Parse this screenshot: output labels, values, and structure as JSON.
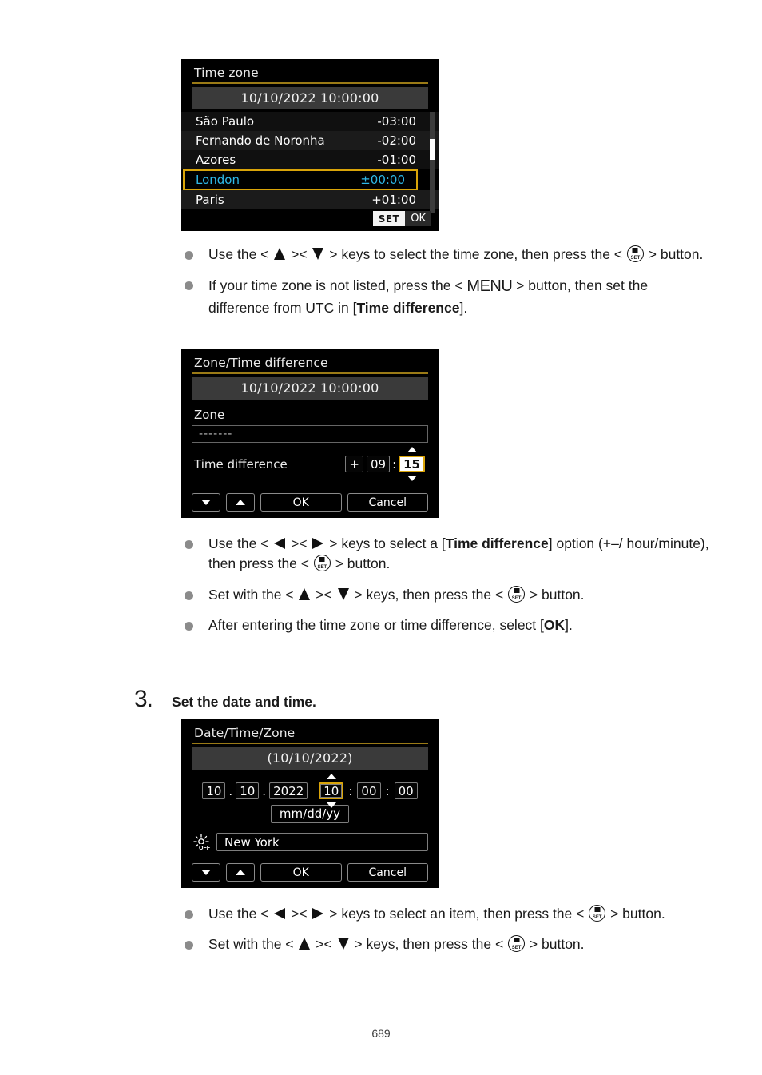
{
  "page": {
    "number": "689"
  },
  "screen_timezone": {
    "title": "Time zone",
    "datetime_bar": "10/10/2022 10:00:00",
    "rows": [
      {
        "name": "São Paulo",
        "offset": "-03:00",
        "selected": false
      },
      {
        "name": "Fernando de Noronha",
        "offset": "-02:00",
        "selected": false
      },
      {
        "name": "Azores",
        "offset": "-01:00",
        "selected": false
      },
      {
        "name": "London",
        "offset": "±00:00",
        "selected": true
      },
      {
        "name": "Paris",
        "offset": "+01:00",
        "selected": false
      }
    ],
    "footer": {
      "set_label": "SET",
      "ok_label": "OK"
    },
    "colors": {
      "highlight_border": "#d9a409",
      "highlight_text": "#2fb8e8",
      "title_rule": "#9a7a16"
    }
  },
  "bullets_after_timezone": [
    {
      "segments": [
        {
          "type": "text",
          "value": "Use the < "
        },
        {
          "type": "icon",
          "value": "arrow-up-key"
        },
        {
          "type": "text",
          "value": " >< "
        },
        {
          "type": "icon",
          "value": "arrow-down-key"
        },
        {
          "type": "text",
          "value": " > keys to select the time zone, then press the < "
        },
        {
          "type": "icon",
          "value": "set-button"
        },
        {
          "type": "text",
          "value": " > button."
        }
      ]
    },
    {
      "segments": [
        {
          "type": "text",
          "value": "If your time zone is not listed, press the < "
        },
        {
          "type": "icon",
          "value": "menu-button"
        },
        {
          "type": "text",
          "value": " > button, then set the difference from UTC in ["
        },
        {
          "type": "bold",
          "value": "Time difference"
        },
        {
          "type": "text",
          "value": "]."
        }
      ]
    }
  ],
  "screen_zonediff": {
    "title": "Zone/Time difference",
    "datetime_bar": "10/10/2022 10:00:00",
    "zone_label": "Zone",
    "zone_value": "-------",
    "time_difference_label": "Time difference",
    "sign": "+",
    "hours": "09",
    "colon": ":",
    "minutes": "15",
    "selected_field": "minutes",
    "buttons": {
      "down_icon": "triangle-down-icon",
      "up_icon": "triangle-up-icon",
      "ok": "OK",
      "cancel": "Cancel"
    }
  },
  "bullets_after_zonediff": [
    {
      "segments": [
        {
          "type": "text",
          "value": "Use the < "
        },
        {
          "type": "icon",
          "value": "arrow-left-key"
        },
        {
          "type": "text",
          "value": " >< "
        },
        {
          "type": "icon",
          "value": "arrow-right-key"
        },
        {
          "type": "text",
          "value": " > keys to select a ["
        },
        {
          "type": "bold",
          "value": "Time difference"
        },
        {
          "type": "text",
          "value": "] option (+–/hour/minute), then press the < "
        },
        {
          "type": "icon",
          "value": "set-button"
        },
        {
          "type": "text",
          "value": " > button."
        }
      ]
    },
    {
      "segments": [
        {
          "type": "text",
          "value": "Set with the < "
        },
        {
          "type": "icon",
          "value": "arrow-up-key"
        },
        {
          "type": "text",
          "value": " >< "
        },
        {
          "type": "icon",
          "value": "arrow-down-key"
        },
        {
          "type": "text",
          "value": " > keys, then press the < "
        },
        {
          "type": "icon",
          "value": "set-button"
        },
        {
          "type": "text",
          "value": " > button."
        }
      ]
    },
    {
      "segments": [
        {
          "type": "text",
          "value": "After entering the time zone or time difference, select ["
        },
        {
          "type": "bold",
          "value": "OK"
        },
        {
          "type": "text",
          "value": "]."
        }
      ]
    }
  ],
  "step": {
    "number": "3.",
    "title": "Set the date and time."
  },
  "screen_datetime": {
    "title": "Date/Time/Zone",
    "date_bar": "(10/10/2022)",
    "month": "10",
    "day": "10",
    "year": "2022",
    "hour": "10",
    "minute": "00",
    "second": "00",
    "selected_field": "hour",
    "separator_date": ".",
    "separator_time": ":",
    "format": "mm/dd/yy",
    "dst_icon": "daylight-saving-off-icon",
    "dst_state": "OFF",
    "zone_value": "New York",
    "buttons": {
      "down_icon": "triangle-down-icon",
      "up_icon": "triangle-up-icon",
      "ok": "OK",
      "cancel": "Cancel"
    }
  },
  "bullets_after_datetime": [
    {
      "segments": [
        {
          "type": "text",
          "value": "Use the < "
        },
        {
          "type": "icon",
          "value": "arrow-left-key"
        },
        {
          "type": "text",
          "value": " >< "
        },
        {
          "type": "icon",
          "value": "arrow-right-key"
        },
        {
          "type": "text",
          "value": " > keys to select an item, then press the < "
        },
        {
          "type": "icon",
          "value": "set-button"
        },
        {
          "type": "text",
          "value": " > button."
        }
      ]
    },
    {
      "segments": [
        {
          "type": "text",
          "value": "Set with the < "
        },
        {
          "type": "icon",
          "value": "arrow-up-key"
        },
        {
          "type": "text",
          "value": " >< "
        },
        {
          "type": "icon",
          "value": "arrow-down-key"
        },
        {
          "type": "text",
          "value": " > keys, then press the < "
        },
        {
          "type": "icon",
          "value": "set-button"
        },
        {
          "type": "text",
          "value": " > button."
        }
      ]
    }
  ]
}
